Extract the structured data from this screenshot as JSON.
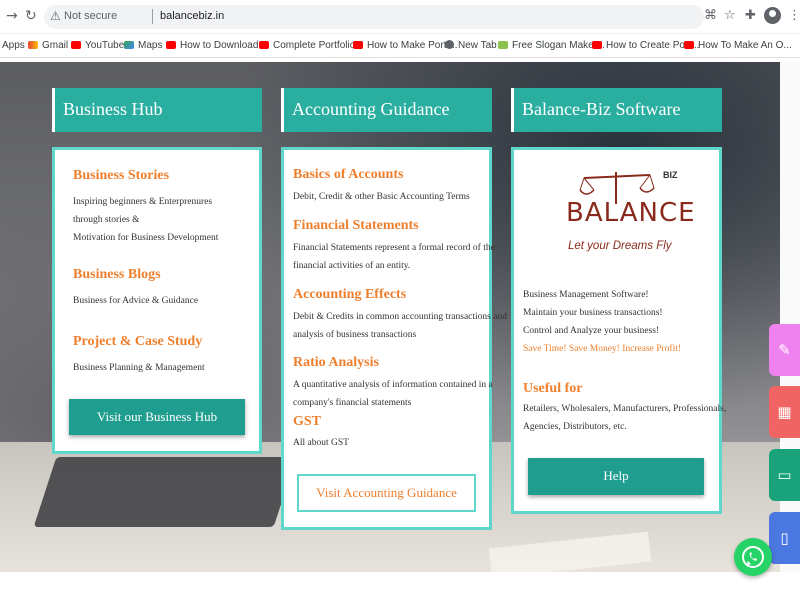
{
  "browser": {
    "security": "Not secure",
    "url": "balancebiz.in",
    "bookmarks": [
      {
        "label": "Apps",
        "icon": "apps-icon"
      },
      {
        "label": "Gmail",
        "icon": "gmail-icon"
      },
      {
        "label": "YouTube",
        "icon": "youtube-icon"
      },
      {
        "label": "Maps",
        "icon": "maps-icon"
      },
      {
        "label": "How to Download...",
        "icon": "youtube-icon"
      },
      {
        "label": "Complete Portfolio...",
        "icon": "youtube-icon"
      },
      {
        "label": "How to Make Portf...",
        "icon": "youtube-icon"
      },
      {
        "label": "New Tab",
        "icon": "globe-icon"
      },
      {
        "label": "Free Slogan Maker...",
        "icon": "slogan-icon"
      },
      {
        "label": "How to Create Port...",
        "icon": "youtube-icon"
      },
      {
        "label": "How To Make An O...",
        "icon": "youtube-icon"
      }
    ]
  },
  "hub": {
    "title": "Business Hub",
    "items": [
      {
        "title": "Business Stories",
        "lines": [
          "Inspiring beginners & Enterprenures",
          "through stories &",
          "Motivation for Business Development"
        ]
      },
      {
        "title": "Business Blogs",
        "lines": [
          "Business for Advice & Guidance"
        ]
      },
      {
        "title": "Project & Case Study",
        "lines": [
          "Business Planning & Management"
        ]
      }
    ],
    "button": "Visit our Business Hub"
  },
  "accounting": {
    "title": "Accounting Guidance",
    "items": [
      {
        "title": "Basics of Accounts",
        "lines": [
          "Debit, Credit & other Basic Accounting Terms"
        ]
      },
      {
        "title": "Financial Statements",
        "lines": [
          "Financial Statements represent a formal record of the",
          "financial activities of an entity."
        ]
      },
      {
        "title": "Accounting Effects",
        "lines": [
          "Debit & Credits in common accounting transactions and",
          "analysis of business transactions"
        ]
      },
      {
        "title": "Ratio Analysis",
        "lines": [
          "A quantitative analysis of information contained in a",
          "company's financial statements"
        ]
      },
      {
        "title": "GST",
        "lines": [
          "All about GST"
        ]
      }
    ],
    "button": "Visit Accounting Guidance"
  },
  "software": {
    "title": "Balance-Biz Software",
    "logo": {
      "text": "BALANCE",
      "badge": "BIZ",
      "tagline": "Let your Dreams Fly"
    },
    "lines": [
      "Business Management Software!",
      "Maintain your business transactions!",
      "Control and Analyze your business!"
    ],
    "highlight": "Save Time! Save Money! Increase Profit!",
    "useful_title": "Useful for",
    "useful_lines": [
      "Retailers, Wholesalers, Manufacturers, Professionals,",
      "Agencies, Distributors, etc."
    ],
    "button": "Help"
  },
  "side_tabs": [
    {
      "icon": "edit-icon",
      "color": "#ee82ee"
    },
    {
      "icon": "calculator-icon",
      "color": "#f06464"
    },
    {
      "icon": "monitor-icon",
      "color": "#1aa37a"
    },
    {
      "icon": "phone-icon",
      "color": "#4a78e0"
    }
  ],
  "colors": {
    "accent": "#2aaea0",
    "title": "#ee7f2d",
    "whatsapp": "#25d366"
  }
}
